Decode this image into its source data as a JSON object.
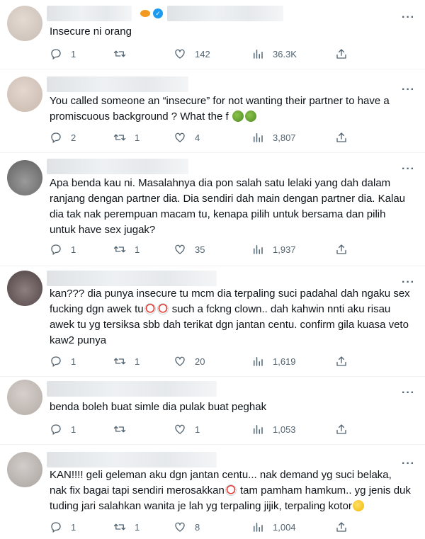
{
  "colors": {
    "text": "#0f1419",
    "muted": "#536471",
    "verified": "#1d9bf0",
    "divider": "#eff3f4"
  },
  "icons": {
    "reply": "reply-icon",
    "retweet": "retweet-icon",
    "like": "heart-icon",
    "views": "views-icon",
    "share": "share-icon",
    "more": "more-icon"
  },
  "replies": [
    {
      "text": "Insecure ni orang",
      "reply_count": "1",
      "retweet_count": "",
      "like_count": "142",
      "view_count": "36.3K"
    },
    {
      "text": "You called someone an “insecure” for not wanting their partner to have a promiscuous background ? What the f",
      "reply_count": "2",
      "retweet_count": "1",
      "like_count": "4",
      "view_count": "3,807"
    },
    {
      "text": "Apa benda kau ni. Masalahnya dia pon salah satu lelaki yang dah dalam ranjang dengan partner dia. Dia sendiri dah main dengan partner dia. Kalau dia tak nak perempuan macam tu, kenapa pilih untuk bersama dan pilih untuk have sex jugak?",
      "reply_count": "1",
      "retweet_count": "1",
      "like_count": "35",
      "view_count": "1,937"
    },
    {
      "text_part1": "kan??? dia punya insecure tu mcm dia terpaling suci padahal dah ngaku sex fucking dgn awek tu",
      "text_part2": " such a fckng clown.. dah kahwin nnti aku risau awek tu yg tersiksa sbb dah terikat dgn jantan centu. confirm gila kuasa veto kaw2 punya",
      "reply_count": "1",
      "retweet_count": "1",
      "like_count": "20",
      "view_count": "1,619"
    },
    {
      "text": "benda boleh buat simle dia pulak buat peghak",
      "reply_count": "1",
      "retweet_count": "",
      "like_count": "1",
      "view_count": "1,053"
    },
    {
      "text_part1": "KAN!!!! geli geleman aku dgn jantan centu... nak demand yg suci belaka, nak fix bagai tapi sendiri merosakkan",
      "text_part2": " tam pamham hamkum.. yg jenis duk tuding jari salahkan wanita je lah yg terpaling jijik, terpaling kotor",
      "reply_count": "1",
      "retweet_count": "1",
      "like_count": "8",
      "view_count": "1,004"
    }
  ]
}
